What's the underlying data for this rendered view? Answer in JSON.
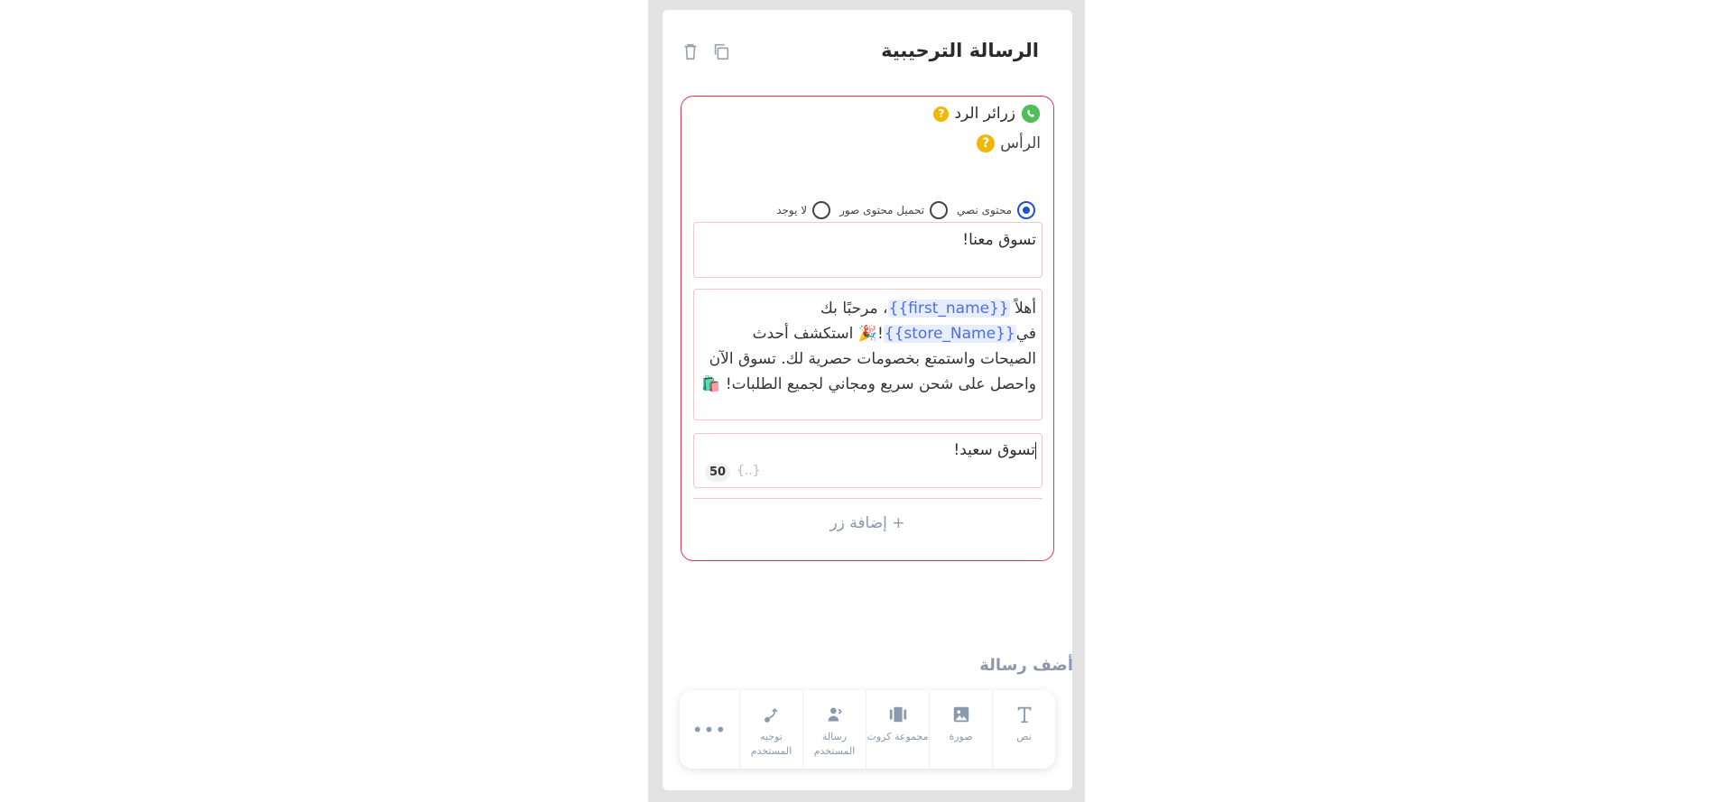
{
  "card": {
    "title": "الرسالة الترحيبية",
    "icons": {
      "delete": "trash-icon",
      "duplicate": "copy-icon"
    }
  },
  "block": {
    "type_label": "زرائر الرد",
    "header_label": "الرأس",
    "help_glyph": "?",
    "radio_options": [
      "محتوى نصي",
      "تحميل محتوى صور",
      "لا يوجد"
    ],
    "radio_selected": "محتوى نصي",
    "header_text": "تسوق معنا!",
    "body": {
      "part1": "أهلاً ",
      "var1": "{{first_name}}",
      "part2": "، مرحبًا بك في",
      "var2": "{{store_Name}}",
      "part3": "!🎉 استكشف أحدث الصيحات واستمتع بخصومات حصرية لك. تسوق الآن واحصل على شحن سريع ومجاني لجميع الطلبات! 🛍️"
    },
    "footer_text": "تسوق سعيد!",
    "var_insert_label": "{..}",
    "char_counter": "50",
    "add_button_label": "+ إضافة زر"
  },
  "add_message": {
    "title": "أضف رسالة",
    "items": [
      {
        "label": "نص",
        "icon": "text-icon"
      },
      {
        "label": "صورة",
        "icon": "image-icon"
      },
      {
        "label": "مجموعة كروت",
        "icon": "carousel-icon"
      },
      {
        "label": "رسالة المستخدم",
        "icon": "user-message-icon"
      },
      {
        "label": "توجيه المستخدم",
        "icon": "route-icon"
      }
    ],
    "more_label": "•••"
  },
  "colors": {
    "block_border": "#e0334b",
    "accent_blue": "#1f4fd8",
    "help_yellow": "#f2b705",
    "whatsapp_green": "#4fbd5a",
    "muted": "#8a9aac"
  }
}
